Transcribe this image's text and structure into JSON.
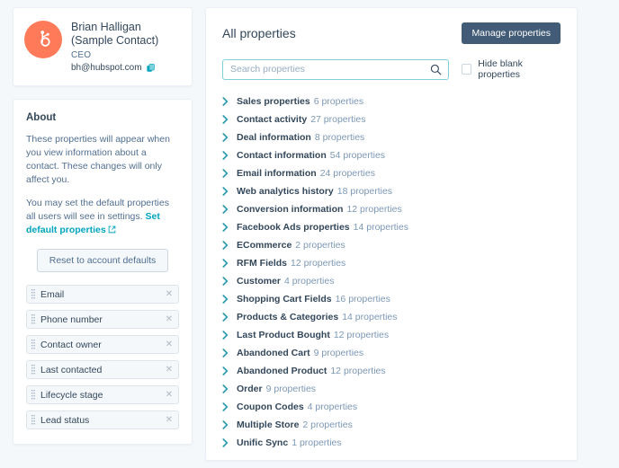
{
  "contact": {
    "avatar_icon": "hubspot-sprocket-icon",
    "name_line1": "Brian Halligan",
    "name_line2": "(Sample Contact)",
    "job_title": "CEO",
    "email": "bh@hubspot.com",
    "copy_icon": "copy-icon"
  },
  "about": {
    "title": "About",
    "paragraph1": "These properties will appear when you view information about a contact. These changes will only affect you.",
    "paragraph2_prefix": "You may set the default properties all users will see in settings. ",
    "link_text": "Set default properties",
    "link_icon": "external-link-icon",
    "reset_button": "Reset to account defaults"
  },
  "chips": [
    {
      "label": "Email",
      "grip_icon": "drag-handle-icon",
      "remove_icon": "close-icon"
    },
    {
      "label": "Phone number",
      "grip_icon": "drag-handle-icon",
      "remove_icon": "close-icon"
    },
    {
      "label": "Contact owner",
      "grip_icon": "drag-handle-icon",
      "remove_icon": "close-icon"
    },
    {
      "label": "Last contacted",
      "grip_icon": "drag-handle-icon",
      "remove_icon": "close-icon"
    },
    {
      "label": "Lifecycle stage",
      "grip_icon": "drag-handle-icon",
      "remove_icon": "close-icon"
    },
    {
      "label": "Lead status",
      "grip_icon": "drag-handle-icon",
      "remove_icon": "close-icon"
    }
  ],
  "panel": {
    "title": "All properties",
    "manage_button": "Manage properties",
    "search": {
      "value": "",
      "placeholder": "Search properties",
      "icon": "search-icon"
    },
    "hide_blank": {
      "label": "Hide blank properties",
      "checked": false
    }
  },
  "groups": [
    {
      "name": "Sales properties",
      "count": "6 properties",
      "chevron": "chevron-right-icon"
    },
    {
      "name": "Contact activity",
      "count": "27 properties",
      "chevron": "chevron-right-icon"
    },
    {
      "name": "Deal information",
      "count": "8 properties",
      "chevron": "chevron-right-icon"
    },
    {
      "name": "Contact information",
      "count": "54 properties",
      "chevron": "chevron-right-icon"
    },
    {
      "name": "Email information",
      "count": "24 properties",
      "chevron": "chevron-right-icon"
    },
    {
      "name": "Web analytics history",
      "count": "18 properties",
      "chevron": "chevron-right-icon"
    },
    {
      "name": "Conversion information",
      "count": "12 properties",
      "chevron": "chevron-right-icon"
    },
    {
      "name": "Facebook Ads properties",
      "count": "14 properties",
      "chevron": "chevron-right-icon"
    },
    {
      "name": "ECommerce",
      "count": "2 properties",
      "chevron": "chevron-right-icon"
    },
    {
      "name": "RFM Fields",
      "count": "12 properties",
      "chevron": "chevron-right-icon"
    },
    {
      "name": "Customer",
      "count": "4 properties",
      "chevron": "chevron-right-icon"
    },
    {
      "name": "Shopping Cart Fields",
      "count": "16 properties",
      "chevron": "chevron-right-icon"
    },
    {
      "name": "Products & Categories",
      "count": "14 properties",
      "chevron": "chevron-right-icon"
    },
    {
      "name": "Last Product Bought",
      "count": "12 properties",
      "chevron": "chevron-right-icon"
    },
    {
      "name": "Abandoned Cart",
      "count": "9 properties",
      "chevron": "chevron-right-icon"
    },
    {
      "name": "Abandoned Product",
      "count": "12 properties",
      "chevron": "chevron-right-icon"
    },
    {
      "name": "Order",
      "count": "9 properties",
      "chevron": "chevron-right-icon"
    },
    {
      "name": "Coupon Codes",
      "count": "4 properties",
      "chevron": "chevron-right-icon"
    },
    {
      "name": "Multiple Store",
      "count": "2 properties",
      "chevron": "chevron-right-icon"
    },
    {
      "name": "Unific Sync",
      "count": "1 properties",
      "chevron": "chevron-right-icon"
    }
  ],
  "colors": {
    "brand_orange": "#ff7a59",
    "teal_link": "#00a4bd",
    "navy_button": "#425b76",
    "text_dark": "#33475b",
    "text_muted": "#516f90",
    "page_bg": "#f5f8fa"
  }
}
